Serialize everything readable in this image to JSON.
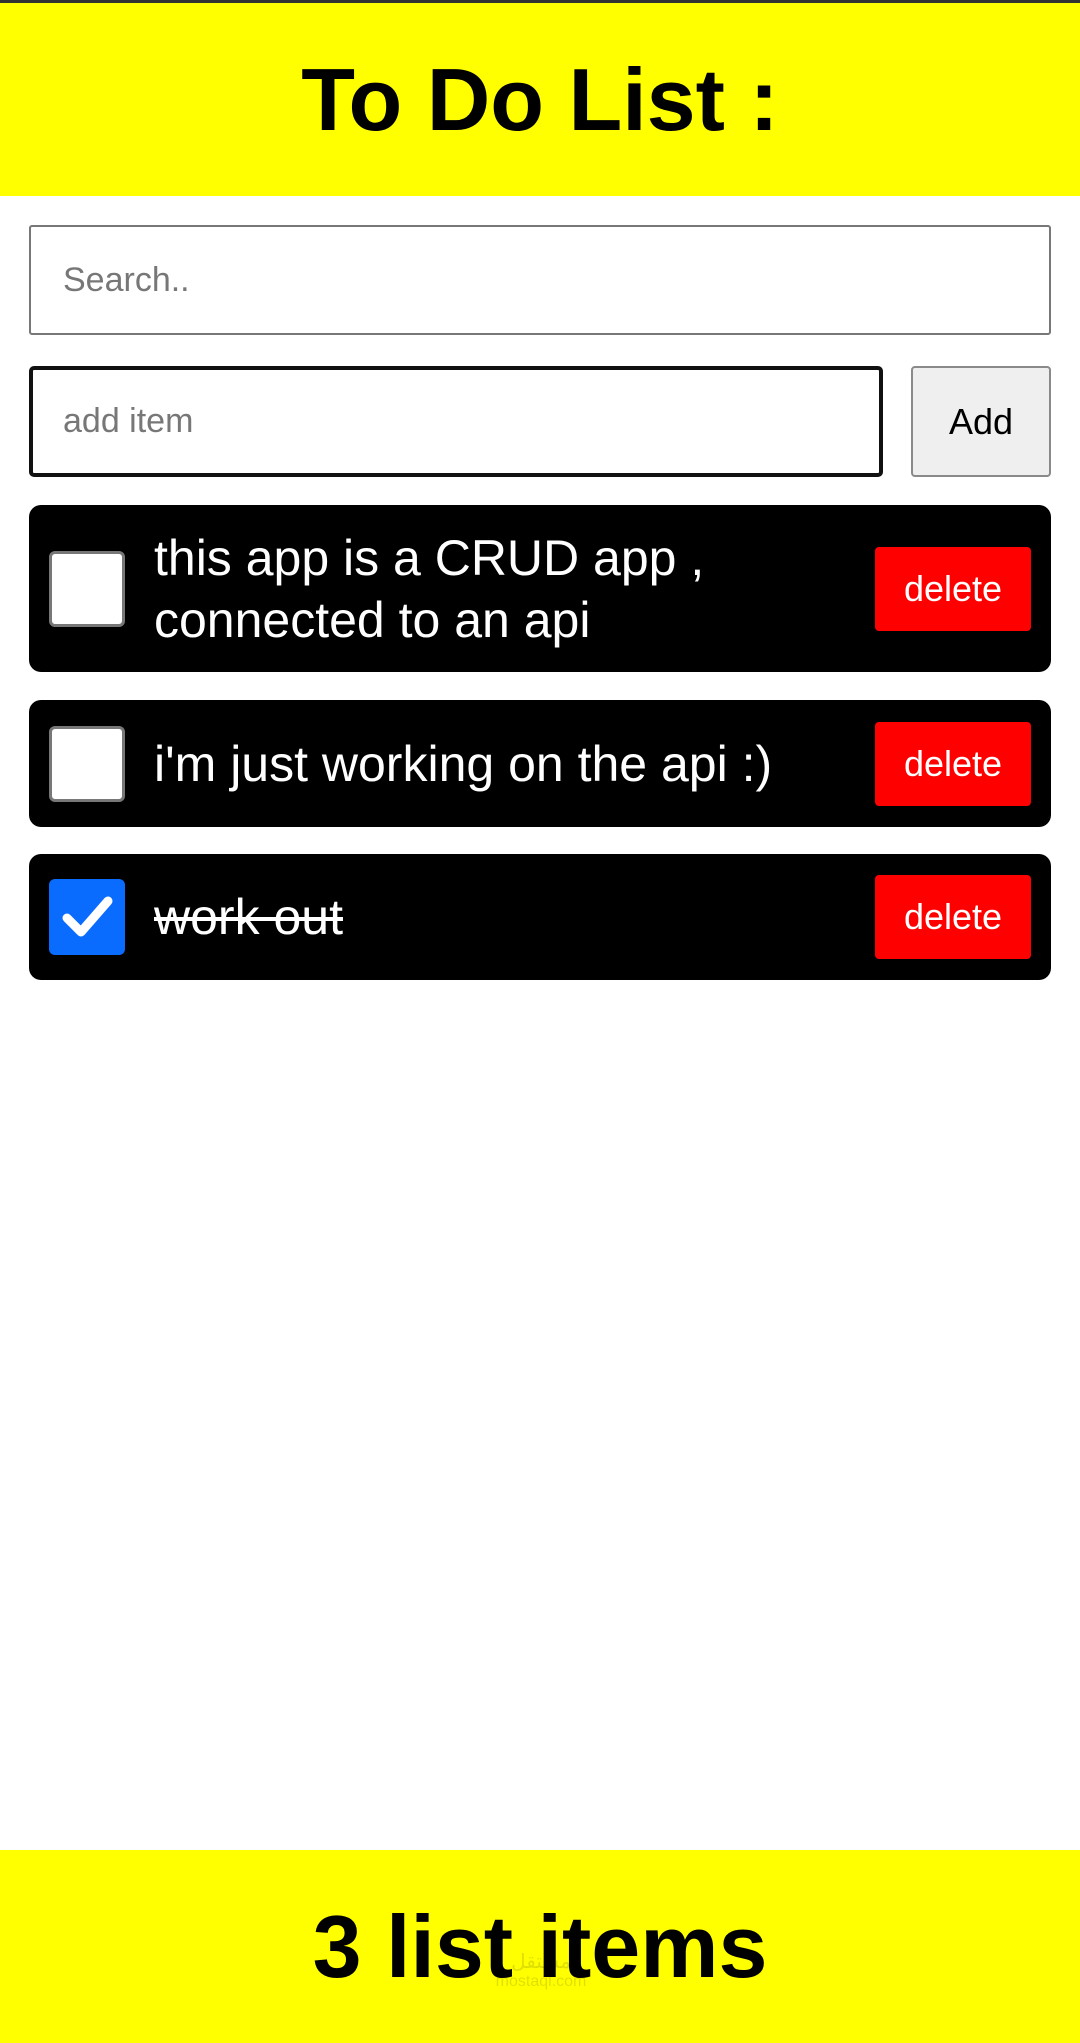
{
  "header": {
    "title": "To Do List :"
  },
  "search": {
    "placeholder": "Search..",
    "value": ""
  },
  "add_item": {
    "placeholder": "add item",
    "value": "",
    "button_label": "Add"
  },
  "todos": [
    {
      "text": "this app is a CRUD app , connected to an api",
      "checked": false,
      "delete_label": "delete"
    },
    {
      "text": "i'm just working on the api :)",
      "checked": false,
      "delete_label": "delete"
    },
    {
      "text": "work out",
      "checked": true,
      "delete_label": "delete"
    }
  ],
  "footer": {
    "count_text": "3 list items"
  },
  "colors": {
    "header_bg": "#ffff00",
    "item_bg": "#000000",
    "delete_bg": "#ff0000",
    "checkbox_checked": "#0a6cff"
  },
  "icons": {
    "checked_box": "checkmark-icon"
  }
}
